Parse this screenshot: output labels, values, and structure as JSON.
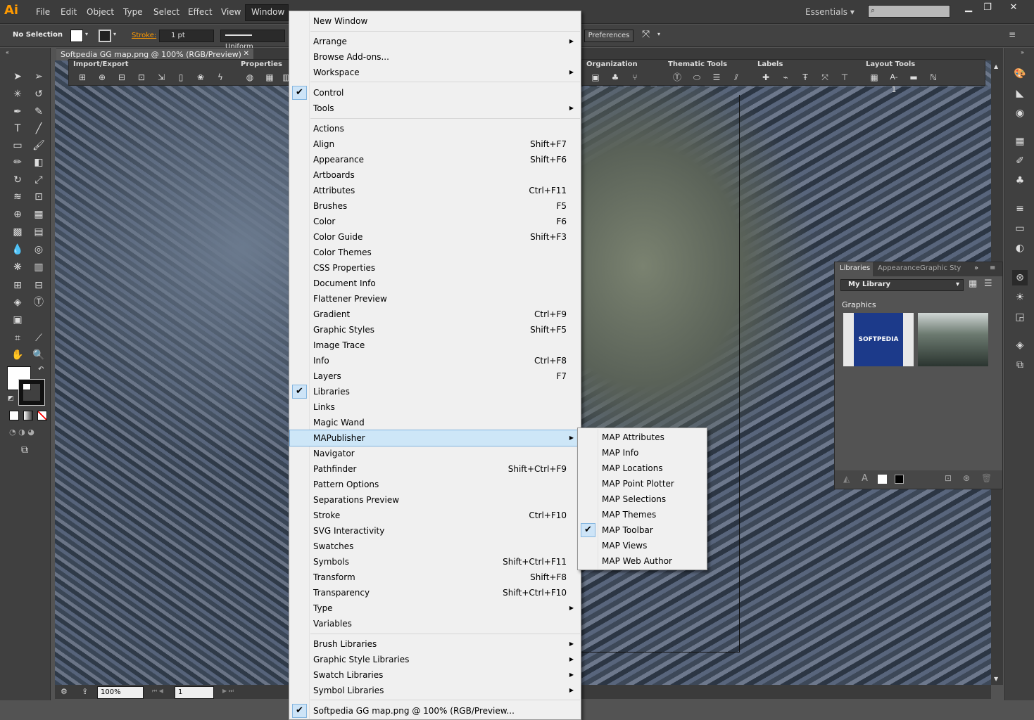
{
  "app": {
    "logo": "Ai",
    "workspace": "Essentials",
    "search_placeholder": ""
  },
  "menubar": {
    "items": [
      "File",
      "Edit",
      "Object",
      "Type",
      "Select",
      "Effect",
      "View",
      "Window"
    ]
  },
  "controlbar": {
    "selection": "No Selection",
    "stroke_label": "Stroke:",
    "stroke_width": "1 pt",
    "stroke_profile": "Uniform",
    "preferences": "Preferences"
  },
  "document": {
    "tab_title": "Softpedia GG map.png @ 100% (RGB/Preview)",
    "zoom": "100%",
    "page": "1"
  },
  "toolbars": {
    "import_export": "Import/Export",
    "properties": "Properties",
    "organization": "Organization",
    "thematic_tools": "Thematic Tools",
    "labels": "Labels",
    "layout_tools": "Layout Tools",
    "layout_label_a1": "A-1"
  },
  "libraries": {
    "tabs": [
      "Libraries",
      "Appearance",
      "Graphic Sty"
    ],
    "selected_library": "My Library",
    "section": "Graphics",
    "thumb1_text": "SOFTPEDIA"
  },
  "window_menu": {
    "items": [
      {
        "label": "New Window",
        "shortcut": "",
        "submenu": false,
        "checked": false
      },
      {
        "label": "Arrange",
        "shortcut": "",
        "submenu": true,
        "checked": false
      },
      {
        "label": "Browse Add-ons...",
        "shortcut": "",
        "submenu": false,
        "checked": false
      },
      {
        "label": "Workspace",
        "shortcut": "",
        "submenu": true,
        "checked": false
      },
      {
        "label": "Control",
        "shortcut": "",
        "submenu": false,
        "checked": true
      },
      {
        "label": "Tools",
        "shortcut": "",
        "submenu": true,
        "checked": false
      },
      {
        "label": "Actions",
        "shortcut": "",
        "submenu": false,
        "checked": false
      },
      {
        "label": "Align",
        "shortcut": "Shift+F7",
        "submenu": false,
        "checked": false
      },
      {
        "label": "Appearance",
        "shortcut": "Shift+F6",
        "submenu": false,
        "checked": false
      },
      {
        "label": "Artboards",
        "shortcut": "",
        "submenu": false,
        "checked": false
      },
      {
        "label": "Attributes",
        "shortcut": "Ctrl+F11",
        "submenu": false,
        "checked": false
      },
      {
        "label": "Brushes",
        "shortcut": "F5",
        "submenu": false,
        "checked": false
      },
      {
        "label": "Color",
        "shortcut": "F6",
        "submenu": false,
        "checked": false
      },
      {
        "label": "Color Guide",
        "shortcut": "Shift+F3",
        "submenu": false,
        "checked": false
      },
      {
        "label": "Color Themes",
        "shortcut": "",
        "submenu": false,
        "checked": false
      },
      {
        "label": "CSS Properties",
        "shortcut": "",
        "submenu": false,
        "checked": false
      },
      {
        "label": "Document Info",
        "shortcut": "",
        "submenu": false,
        "checked": false
      },
      {
        "label": "Flattener Preview",
        "shortcut": "",
        "submenu": false,
        "checked": false
      },
      {
        "label": "Gradient",
        "shortcut": "Ctrl+F9",
        "submenu": false,
        "checked": false
      },
      {
        "label": "Graphic Styles",
        "shortcut": "Shift+F5",
        "submenu": false,
        "checked": false
      },
      {
        "label": "Image Trace",
        "shortcut": "",
        "submenu": false,
        "checked": false
      },
      {
        "label": "Info",
        "shortcut": "Ctrl+F8",
        "submenu": false,
        "checked": false
      },
      {
        "label": "Layers",
        "shortcut": "F7",
        "submenu": false,
        "checked": false
      },
      {
        "label": "Libraries",
        "shortcut": "",
        "submenu": false,
        "checked": true
      },
      {
        "label": "Links",
        "shortcut": "",
        "submenu": false,
        "checked": false
      },
      {
        "label": "Magic Wand",
        "shortcut": "",
        "submenu": false,
        "checked": false
      },
      {
        "label": "MAPublisher",
        "shortcut": "",
        "submenu": true,
        "checked": false,
        "highlighted": true
      },
      {
        "label": "Navigator",
        "shortcut": "",
        "submenu": false,
        "checked": false
      },
      {
        "label": "Pathfinder",
        "shortcut": "Shift+Ctrl+F9",
        "submenu": false,
        "checked": false
      },
      {
        "label": "Pattern Options",
        "shortcut": "",
        "submenu": false,
        "checked": false
      },
      {
        "label": "Separations Preview",
        "shortcut": "",
        "submenu": false,
        "checked": false
      },
      {
        "label": "Stroke",
        "shortcut": "Ctrl+F10",
        "submenu": false,
        "checked": false
      },
      {
        "label": "SVG Interactivity",
        "shortcut": "",
        "submenu": false,
        "checked": false
      },
      {
        "label": "Swatches",
        "shortcut": "",
        "submenu": false,
        "checked": false
      },
      {
        "label": "Symbols",
        "shortcut": "Shift+Ctrl+F11",
        "submenu": false,
        "checked": false
      },
      {
        "label": "Transform",
        "shortcut": "Shift+F8",
        "submenu": false,
        "checked": false
      },
      {
        "label": "Transparency",
        "shortcut": "Shift+Ctrl+F10",
        "submenu": false,
        "checked": false
      },
      {
        "label": "Type",
        "shortcut": "",
        "submenu": true,
        "checked": false
      },
      {
        "label": "Variables",
        "shortcut": "",
        "submenu": false,
        "checked": false
      },
      {
        "label": "Brush Libraries",
        "shortcut": "",
        "submenu": true,
        "checked": false
      },
      {
        "label": "Graphic Style Libraries",
        "shortcut": "",
        "submenu": true,
        "checked": false
      },
      {
        "label": "Swatch Libraries",
        "shortcut": "",
        "submenu": true,
        "checked": false
      },
      {
        "label": "Symbol Libraries",
        "shortcut": "",
        "submenu": true,
        "checked": false
      },
      {
        "label": "Softpedia GG map.png @ 100% (RGB/Preview...",
        "shortcut": "",
        "submenu": false,
        "checked": true
      }
    ]
  },
  "mapublisher_menu": {
    "items": [
      {
        "label": "MAP Attributes",
        "checked": false
      },
      {
        "label": "MAP Info",
        "checked": false
      },
      {
        "label": "MAP Locations",
        "checked": false
      },
      {
        "label": "MAP Point Plotter",
        "checked": false
      },
      {
        "label": "MAP Selections",
        "checked": false
      },
      {
        "label": "MAP Themes",
        "checked": false
      },
      {
        "label": "MAP Toolbar",
        "checked": true
      },
      {
        "label": "MAP Views",
        "checked": false
      },
      {
        "label": "MAP Web Author",
        "checked": false
      }
    ]
  },
  "colors": {
    "menu_bg": "#f0f0f0",
    "highlight": "#cde6f7",
    "check_bg": "#cde4f7",
    "accent_orange": "#ff9a00",
    "chrome_dark": "#3c3c3c"
  }
}
